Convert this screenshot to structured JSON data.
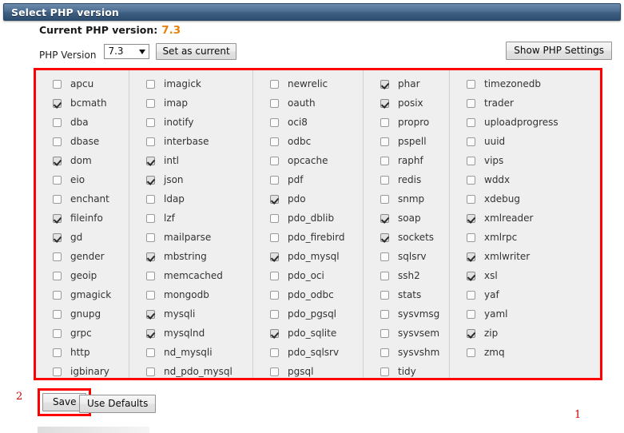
{
  "window": {
    "title": "Select PHP version"
  },
  "current": {
    "label": "Current PHP version:",
    "value": "7.3",
    "value_color": "#e8820c"
  },
  "version_selector": {
    "label": "PHP Version",
    "selected": "7.3",
    "set_button": "Set as current",
    "show_settings_button": "Show PHP Settings"
  },
  "annotations": {
    "one": "1",
    "two": "2"
  },
  "actions": {
    "save": "Save",
    "use_defaults": "Use Defaults"
  },
  "colors": {
    "highlight_box": "#ff0000",
    "titlebar": "#3f5f82",
    "accent_value": "#e8820c"
  },
  "extensions": {
    "columns": [
      {
        "items": [
          {
            "name": "apcu",
            "checked": false
          },
          {
            "name": "bcmath",
            "checked": true
          },
          {
            "name": "dba",
            "checked": false
          },
          {
            "name": "dbase",
            "checked": false
          },
          {
            "name": "dom",
            "checked": true
          },
          {
            "name": "eio",
            "checked": false
          },
          {
            "name": "enchant",
            "checked": false
          },
          {
            "name": "fileinfo",
            "checked": true
          },
          {
            "name": "gd",
            "checked": true
          },
          {
            "name": "gender",
            "checked": false
          },
          {
            "name": "geoip",
            "checked": false
          },
          {
            "name": "gmagick",
            "checked": false
          },
          {
            "name": "gnupg",
            "checked": false
          },
          {
            "name": "grpc",
            "checked": false
          },
          {
            "name": "http",
            "checked": false
          },
          {
            "name": "igbinary",
            "checked": false
          }
        ]
      },
      {
        "items": [
          {
            "name": "imagick",
            "checked": false
          },
          {
            "name": "imap",
            "checked": false
          },
          {
            "name": "inotify",
            "checked": false
          },
          {
            "name": "interbase",
            "checked": false
          },
          {
            "name": "intl",
            "checked": true
          },
          {
            "name": "json",
            "checked": true
          },
          {
            "name": "ldap",
            "checked": false
          },
          {
            "name": "lzf",
            "checked": false
          },
          {
            "name": "mailparse",
            "checked": false
          },
          {
            "name": "mbstring",
            "checked": true
          },
          {
            "name": "memcached",
            "checked": false
          },
          {
            "name": "mongodb",
            "checked": false
          },
          {
            "name": "mysqli",
            "checked": true
          },
          {
            "name": "mysqlnd",
            "checked": true
          },
          {
            "name": "nd_mysqli",
            "checked": false
          },
          {
            "name": "nd_pdo_mysql",
            "checked": false
          }
        ]
      },
      {
        "items": [
          {
            "name": "newrelic",
            "checked": false
          },
          {
            "name": "oauth",
            "checked": false
          },
          {
            "name": "oci8",
            "checked": false
          },
          {
            "name": "odbc",
            "checked": false
          },
          {
            "name": "opcache",
            "checked": false
          },
          {
            "name": "pdf",
            "checked": false
          },
          {
            "name": "pdo",
            "checked": true
          },
          {
            "name": "pdo_dblib",
            "checked": false
          },
          {
            "name": "pdo_firebird",
            "checked": false
          },
          {
            "name": "pdo_mysql",
            "checked": true
          },
          {
            "name": "pdo_oci",
            "checked": false
          },
          {
            "name": "pdo_odbc",
            "checked": false
          },
          {
            "name": "pdo_pgsql",
            "checked": false
          },
          {
            "name": "pdo_sqlite",
            "checked": true
          },
          {
            "name": "pdo_sqlsrv",
            "checked": false
          },
          {
            "name": "pgsql",
            "checked": false
          }
        ]
      },
      {
        "items": [
          {
            "name": "phar",
            "checked": true
          },
          {
            "name": "posix",
            "checked": true
          },
          {
            "name": "propro",
            "checked": false
          },
          {
            "name": "pspell",
            "checked": false
          },
          {
            "name": "raphf",
            "checked": false
          },
          {
            "name": "redis",
            "checked": false
          },
          {
            "name": "snmp",
            "checked": false
          },
          {
            "name": "soap",
            "checked": true
          },
          {
            "name": "sockets",
            "checked": true
          },
          {
            "name": "sqlsrv",
            "checked": false
          },
          {
            "name": "ssh2",
            "checked": false
          },
          {
            "name": "stats",
            "checked": false
          },
          {
            "name": "sysvmsg",
            "checked": false
          },
          {
            "name": "sysvsem",
            "checked": false
          },
          {
            "name": "sysvshm",
            "checked": false
          },
          {
            "name": "tidy",
            "checked": false
          }
        ]
      },
      {
        "items": [
          {
            "name": "timezonedb",
            "checked": false
          },
          {
            "name": "trader",
            "checked": false
          },
          {
            "name": "uploadprogress",
            "checked": false
          },
          {
            "name": "uuid",
            "checked": false
          },
          {
            "name": "vips",
            "checked": false
          },
          {
            "name": "wddx",
            "checked": false
          },
          {
            "name": "xdebug",
            "checked": false
          },
          {
            "name": "xmlreader",
            "checked": true
          },
          {
            "name": "xmlrpc",
            "checked": false
          },
          {
            "name": "xmlwriter",
            "checked": true
          },
          {
            "name": "xsl",
            "checked": true
          },
          {
            "name": "yaf",
            "checked": false
          },
          {
            "name": "yaml",
            "checked": false
          },
          {
            "name": "zip",
            "checked": true
          },
          {
            "name": "zmq",
            "checked": false
          }
        ]
      }
    ]
  }
}
